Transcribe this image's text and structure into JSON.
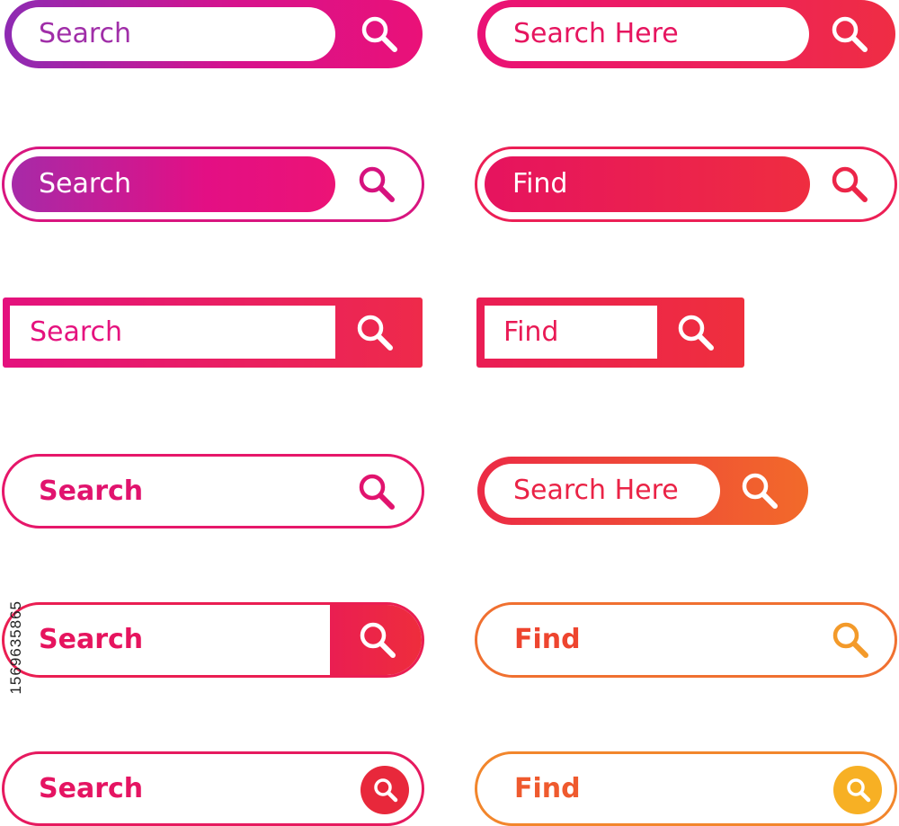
{
  "search_bars": [
    {
      "label": "Search",
      "icon": "search-icon",
      "accent": "#d6128d"
    },
    {
      "label": "Search Here",
      "icon": "search-icon",
      "accent": "#ea1176"
    },
    {
      "label": "Search",
      "icon": "search-icon",
      "accent": "#e30f84"
    },
    {
      "label": "Find",
      "icon": "search-icon",
      "accent": "#ef2d40"
    },
    {
      "label": "Search",
      "icon": "search-icon",
      "accent": "#e4117e"
    },
    {
      "label": "Find",
      "icon": "search-icon",
      "accent": "#ea1d55"
    },
    {
      "label": "Search",
      "icon": "search-icon",
      "accent": "#e6176a"
    },
    {
      "label": "Search Here",
      "icon": "search-icon",
      "accent": "#f26a2a"
    },
    {
      "label": "Search",
      "icon": "search-icon",
      "accent": "#ea1e52"
    },
    {
      "label": "Find",
      "icon": "search-icon",
      "accent": "#f07030"
    },
    {
      "label": "Search",
      "icon": "search-icon",
      "accent": "#e8283b"
    },
    {
      "label": "Find",
      "icon": "search-icon",
      "accent": "#f7b024"
    }
  ],
  "watermark": "1569635865"
}
